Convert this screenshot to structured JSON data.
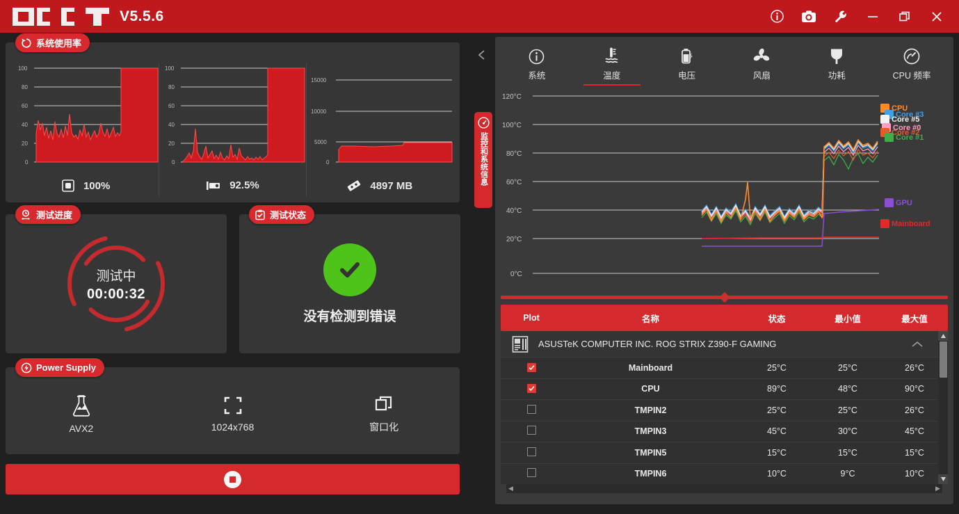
{
  "app": {
    "name": "OCCT",
    "version": "V5.5.6"
  },
  "titlebar": {
    "buttons": [
      {
        "name": "info-icon",
        "label": "Info"
      },
      {
        "name": "camera-icon",
        "label": "Screenshot"
      },
      {
        "name": "wrench-icon",
        "label": "Settings"
      },
      {
        "name": "minimize-icon",
        "label": "Minimize"
      },
      {
        "name": "restore-icon",
        "label": "Restore"
      },
      {
        "name": "close-icon",
        "label": "Close"
      }
    ]
  },
  "usage": {
    "badge": "系统使用率",
    "charts": [
      {
        "icon": "cpu-chip-icon",
        "value": "100%",
        "ticks": [
          "100",
          "80",
          "60",
          "40",
          "20",
          "0"
        ]
      },
      {
        "icon": "gpu-card-icon",
        "value": "92.5%",
        "ticks": [
          "100",
          "80",
          "60",
          "40",
          "20",
          "0"
        ]
      },
      {
        "icon": "memory-stick-icon",
        "value": "4897 MB",
        "ticks": [
          "15000",
          "10000",
          "5000",
          "0"
        ]
      }
    ]
  },
  "progress": {
    "badge": "测试进度",
    "state": "测试中",
    "elapsed": "00:00:32"
  },
  "status": {
    "badge": "测试状态",
    "message": "没有检测到错误",
    "ok_color": "#4ec41a"
  },
  "power_supply": {
    "badge": "Power Supply",
    "items": [
      {
        "icon": "flask-icon",
        "label": "AVX2"
      },
      {
        "icon": "fullscreen-icon",
        "label": "1024x768"
      },
      {
        "icon": "windowed-icon",
        "label": "窗口化"
      }
    ]
  },
  "stop_button": {
    "label": "",
    "icon": "stop-icon"
  },
  "splitter": {
    "collapse_icon": "chevron-left-icon",
    "vertical_tab": "监控和系统信息",
    "gauge_icon": "gauge-icon"
  },
  "tabs": [
    {
      "label": "系统",
      "icon": "info-circle-icon",
      "active": false
    },
    {
      "label": "温度",
      "icon": "thermometer-icon",
      "active": true
    },
    {
      "label": "电压",
      "icon": "battery-bolt-icon",
      "active": false
    },
    {
      "label": "风扇",
      "icon": "fan-icon",
      "active": false
    },
    {
      "label": "功耗",
      "icon": "plug-icon",
      "active": false
    },
    {
      "label": "CPU 频率",
      "icon": "speedometer-icon",
      "active": false
    }
  ],
  "chart_data": {
    "type": "line",
    "title": "",
    "xlabel": "",
    "ylabel": "",
    "ylim": [
      0,
      120
    ],
    "grid": true,
    "yticks": [
      "0°C",
      "20°C",
      "40°C",
      "60°C",
      "80°C",
      "100°C",
      "120°C"
    ],
    "legend_position": "right",
    "series": [
      {
        "name": "CPU",
        "color": "#ff8c2b",
        "idle": 45,
        "load": 89
      },
      {
        "name": "Core #3",
        "color": "#3fa0e8",
        "idle": 43,
        "load": 86
      },
      {
        "name": "Core #5",
        "color": "#f2f2f2",
        "idle": 44,
        "load": 87
      },
      {
        "name": "Core #0",
        "color": "#ff9ec4",
        "idle": 42,
        "load": 85
      },
      {
        "name": "Core #2",
        "color": "#e85b2b",
        "idle": 41,
        "load": 84
      },
      {
        "name": "Core #1",
        "color": "#3fae4a",
        "idle": 40,
        "load": 82
      },
      {
        "name": "GPU",
        "color": "#8c4fd4",
        "idle": 19,
        "load": 42
      },
      {
        "name": "Mainboard",
        "color": "#e02a2a",
        "idle": 24,
        "load": 25
      }
    ]
  },
  "table": {
    "headers": [
      "Plot",
      "名称",
      "状态",
      "最小值",
      "最大值"
    ],
    "group": {
      "name": "ASUSTeK COMPUTER INC. ROG STRIX Z390-F GAMING",
      "icon": "motherboard-icon",
      "collapse_icon": "chevron-up-icon"
    },
    "rows": [
      {
        "checked": true,
        "name": "Mainboard",
        "state": "25°C",
        "min": "25°C",
        "max": "26°C"
      },
      {
        "checked": true,
        "name": "CPU",
        "state": "89°C",
        "min": "48°C",
        "max": "90°C"
      },
      {
        "checked": false,
        "name": "TMPIN2",
        "state": "25°C",
        "min": "25°C",
        "max": "26°C"
      },
      {
        "checked": false,
        "name": "TMPIN3",
        "state": "45°C",
        "min": "30°C",
        "max": "45°C"
      },
      {
        "checked": false,
        "name": "TMPIN5",
        "state": "15°C",
        "min": "15°C",
        "max": "15°C"
      },
      {
        "checked": false,
        "name": "TMPIN6",
        "state": "10°C",
        "min": "9°C",
        "max": "10°C"
      }
    ]
  }
}
